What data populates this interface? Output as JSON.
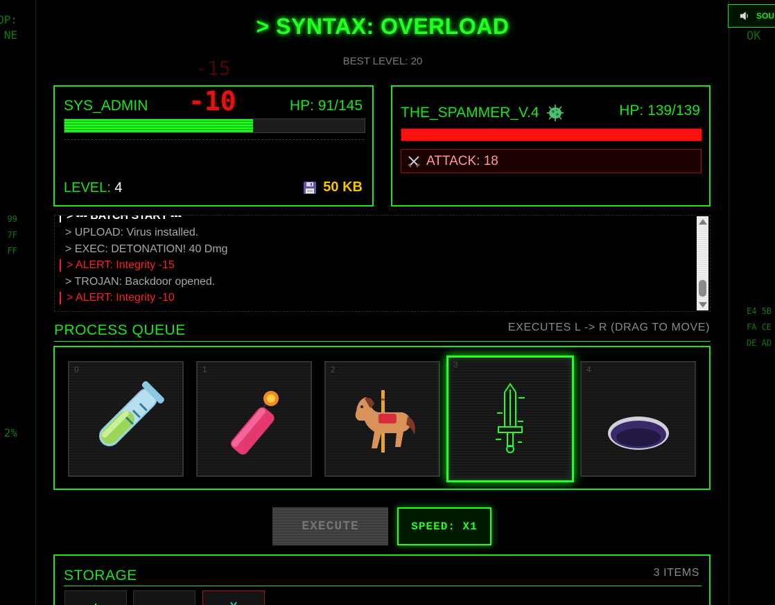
{
  "title": "> SYNTAX: OVERLOAD",
  "best_level": "BEST LEVEL: 20",
  "sound_button": {
    "label": "SOU",
    "icon": "speaker-icon"
  },
  "side_status": "OK",
  "left_gutter": {
    "top": "OP:\nNE",
    "mid": "99\n7F\nFF",
    "pct": "2%"
  },
  "right_gutter": {
    "hex": "E4 5B\nFA CE\nDE AD"
  },
  "floating_damage": [
    "-15",
    "-10"
  ],
  "player": {
    "name": "SYS_ADMIN",
    "hp_text": "HP: 91/145",
    "hp_current": 91,
    "hp_max": 145,
    "level_label": "LEVEL:",
    "level_value": "4",
    "memory": "50 KB",
    "memory_icon": "floppy-disk-icon"
  },
  "enemy": {
    "name": "THE_SPAMMER_V.4",
    "icon": "virus-icon",
    "hp_text": "HP: 139/139",
    "hp_current": 139,
    "hp_max": 139,
    "attack": "ATTACK: 18",
    "attack_icon": "crossed-swords-icon"
  },
  "log": [
    {
      "text": "> --- BATCH START ---",
      "type": "header"
    },
    {
      "text": "> UPLOAD: Virus installed.",
      "type": "info"
    },
    {
      "text": "> EXEC: DETONATION! 40 Dmg",
      "type": "info"
    },
    {
      "text": "> ALERT: Integrity -15",
      "type": "alert"
    },
    {
      "text": "> TROJAN: Backdoor opened.",
      "type": "info"
    },
    {
      "text": "> ALERT: Integrity -10",
      "type": "alert"
    }
  ],
  "queue": {
    "title": "PROCESS QUEUE",
    "note": "EXECUTES L -> R (DRAG TO MOVE)",
    "slots": [
      {
        "index": "0",
        "icon": "test-tube-icon"
      },
      {
        "index": "1",
        "icon": "dynamite-icon"
      },
      {
        "index": "2",
        "icon": "carousel-horse-icon"
      },
      {
        "index": "3",
        "icon": "glitch-sword-icon",
        "selected": true
      },
      {
        "index": "4",
        "icon": "hole-icon"
      }
    ]
  },
  "controls": {
    "execute": "EXECUTE",
    "speed": "SPEED: X1"
  },
  "storage": {
    "title": "STORAGE",
    "count": "3 ITEMS"
  },
  "colors": {
    "primary": "#19e619",
    "alert": "#ff2020",
    "gold": "#f5c400",
    "enemy_hp": "#ff1010"
  }
}
